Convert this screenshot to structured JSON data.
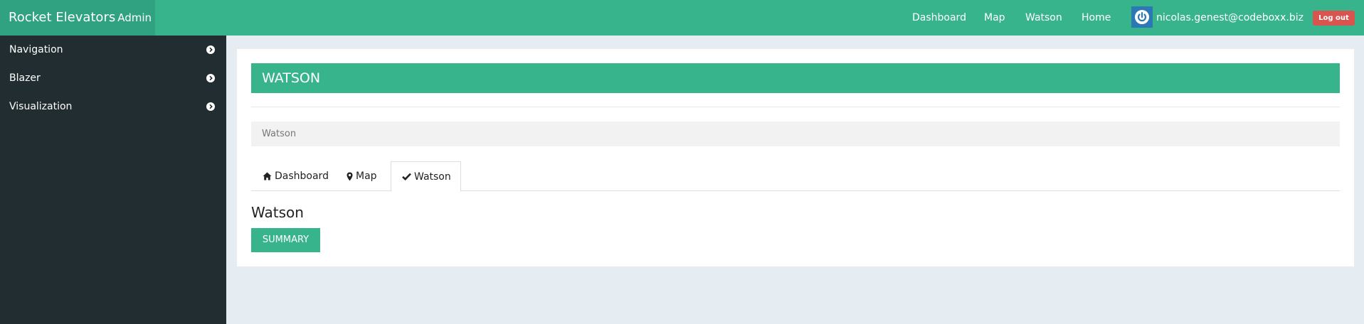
{
  "brand": {
    "main": "Rocket Elevators",
    "sub": "Admin"
  },
  "topnav": {
    "links": [
      {
        "label": "Dashboard"
      },
      {
        "label": "Map"
      },
      {
        "label": "Watson"
      },
      {
        "label": "Home"
      }
    ],
    "user_email": "nicolas.genest@codeboxx.biz",
    "logout_label": "Log out"
  },
  "sidebar": {
    "items": [
      {
        "label": "Navigation",
        "icon": "chevron-circle-right-icon"
      },
      {
        "label": "Blazer",
        "icon": "chevron-circle-right-icon"
      },
      {
        "label": "Visualization",
        "icon": "chevron-circle-right-icon"
      }
    ]
  },
  "main": {
    "header_title": "WATSON",
    "breadcrumb": "Watson",
    "tabs": [
      {
        "label": "Dashboard",
        "icon": "home-icon",
        "active": false
      },
      {
        "label": "Map",
        "icon": "map-marker-icon",
        "active": false
      },
      {
        "label": "Watson",
        "icon": "check-icon",
        "active": true
      }
    ],
    "section_title": "Watson",
    "summary_label": "SUMMARY"
  },
  "colors": {
    "accent": "#38b48d",
    "brand_bg": "#30a281",
    "sidebar_bg": "#222d32",
    "page_bg": "#e5ecf2",
    "logout_bg": "#d9534f",
    "avatar_bg": "#2b78b5"
  }
}
